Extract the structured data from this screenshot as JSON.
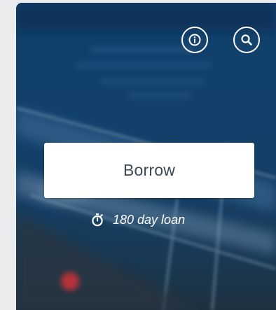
{
  "borrow_card": {
    "primary_button_label": "Borrow",
    "loan_duration_text": "180 day loan"
  },
  "icons": {
    "info": "info-icon",
    "search": "search-icon",
    "timer": "stopwatch-icon"
  },
  "colors": {
    "background_blue": "#12406b",
    "button_bg": "#ffffff",
    "button_text": "#3d4a55",
    "icon_stroke": "#ffffff"
  }
}
